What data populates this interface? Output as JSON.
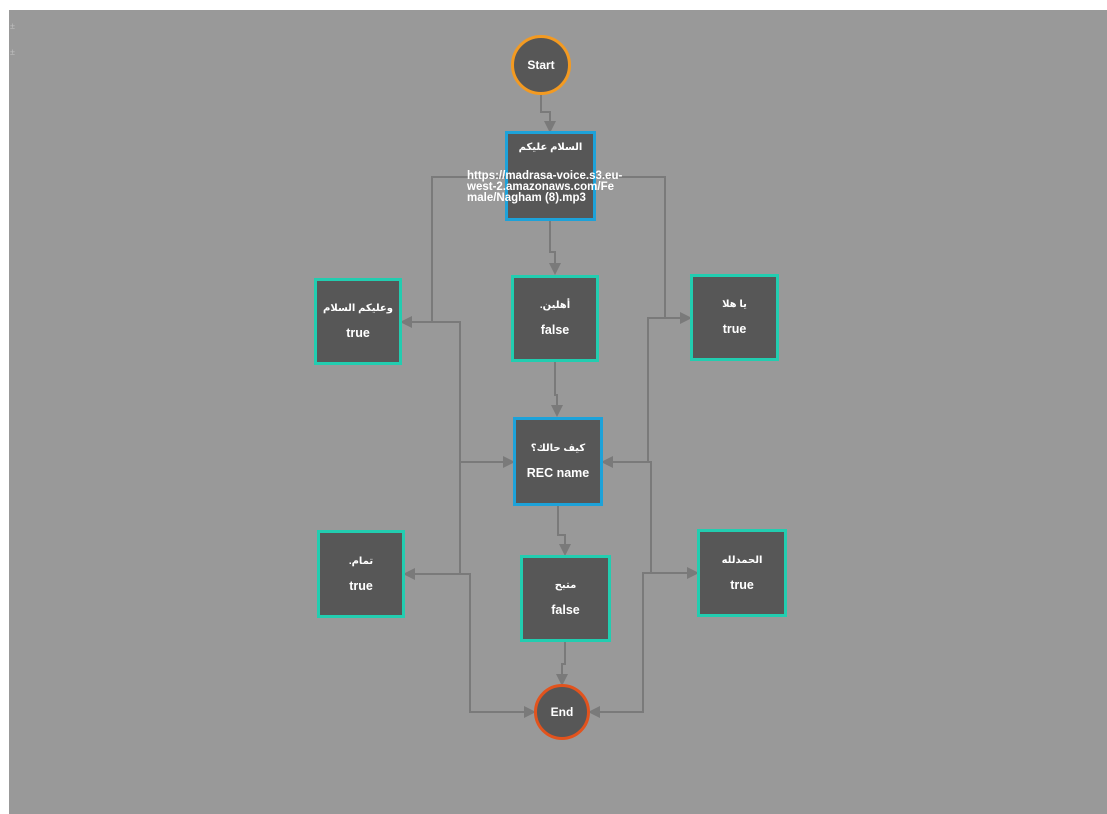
{
  "nodes": {
    "start": {
      "label": "Start"
    },
    "greeting": {
      "title": "السلام عليكم",
      "url_lines": [
        "https://madrasa-voice.s3.eu-",
        "west-2.amazonaws.com/Fe",
        "male/Nagham (8).mp3"
      ]
    },
    "reply_left": {
      "title": "وعليكم السلام",
      "value": "true"
    },
    "reply_mid": {
      "title": "أهلين.",
      "value": "false"
    },
    "reply_right": {
      "title": "يا هلا",
      "value": "true"
    },
    "question": {
      "title": "كيف حالك؟",
      "value": "REC name"
    },
    "answer_left": {
      "title": "تمام.",
      "value": "true"
    },
    "answer_mid": {
      "title": "متبح",
      "value": "false"
    },
    "answer_right": {
      "title": "الحمدلله",
      "value": "true"
    },
    "end": {
      "label": "End"
    }
  },
  "colors": {
    "canvas": "#999999",
    "node_fill": "#575757",
    "border_green": "#22cdb0",
    "border_blue": "#1da2d9",
    "start_border": "#f39a21",
    "end_border": "#e2531d",
    "edge": "#7a7a7a"
  }
}
